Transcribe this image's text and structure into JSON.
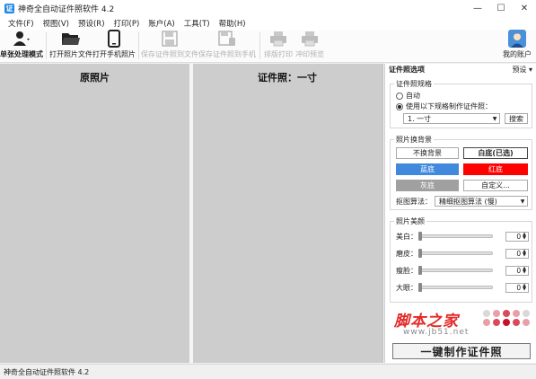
{
  "window": {
    "title": "神奇全自动证件照软件 4.2",
    "app_icon_glyph": "证",
    "minimize": "—",
    "maximize": "☐",
    "close": "✕"
  },
  "menu": [
    "文件(F)",
    "视图(V)",
    "预设(R)",
    "打印(P)",
    "账户(A)",
    "工具(T)",
    "帮助(H)"
  ],
  "toolbar": {
    "single_mode": "单张处理模式",
    "open_file": "打开照片文件",
    "open_phone": "打开手机照片",
    "save_file": "保存证件照到文件",
    "save_phone": "保存证件照到手机",
    "print": "排版打印",
    "print_preview": "冲印预览",
    "my_account": "我的账户"
  },
  "canvas": {
    "original_title": "原照片",
    "id_photo_title": "证件照：一寸"
  },
  "panel": {
    "header": "证件照选项",
    "preset": "预设",
    "spec_group": "证件照规格",
    "auto": "自动",
    "use_spec": "使用以下规格制作证件照：",
    "spec_value": "1. 一寸",
    "search": "搜索",
    "bg_group": "照片换背景",
    "no_change": "不换背景",
    "white": "白底(已选)",
    "blue": "蓝底",
    "red": "红底",
    "gray": "灰底",
    "custom": "自定义...",
    "algo_label": "抠图算法：",
    "algo_value": "精细抠图算法 (慢)",
    "beauty_group": "照片美颜",
    "sliders": [
      {
        "label": "美白：",
        "value": "0"
      },
      {
        "label": "磨皮：",
        "value": "0"
      },
      {
        "label": "瘦脸：",
        "value": "0"
      },
      {
        "label": "大眼：",
        "value": "0"
      }
    ],
    "watermark_text": "脚本之家",
    "watermark_url": "www.jb51.net",
    "make_button": "一键制作证件照"
  },
  "status": "神奇全自动证件照软件 4.2",
  "colors": {
    "blue_bg": "#4189dd",
    "red_bg": "#ff0000",
    "gray_bg": "#a0a0a0",
    "canvas": "#cdcdcd"
  }
}
